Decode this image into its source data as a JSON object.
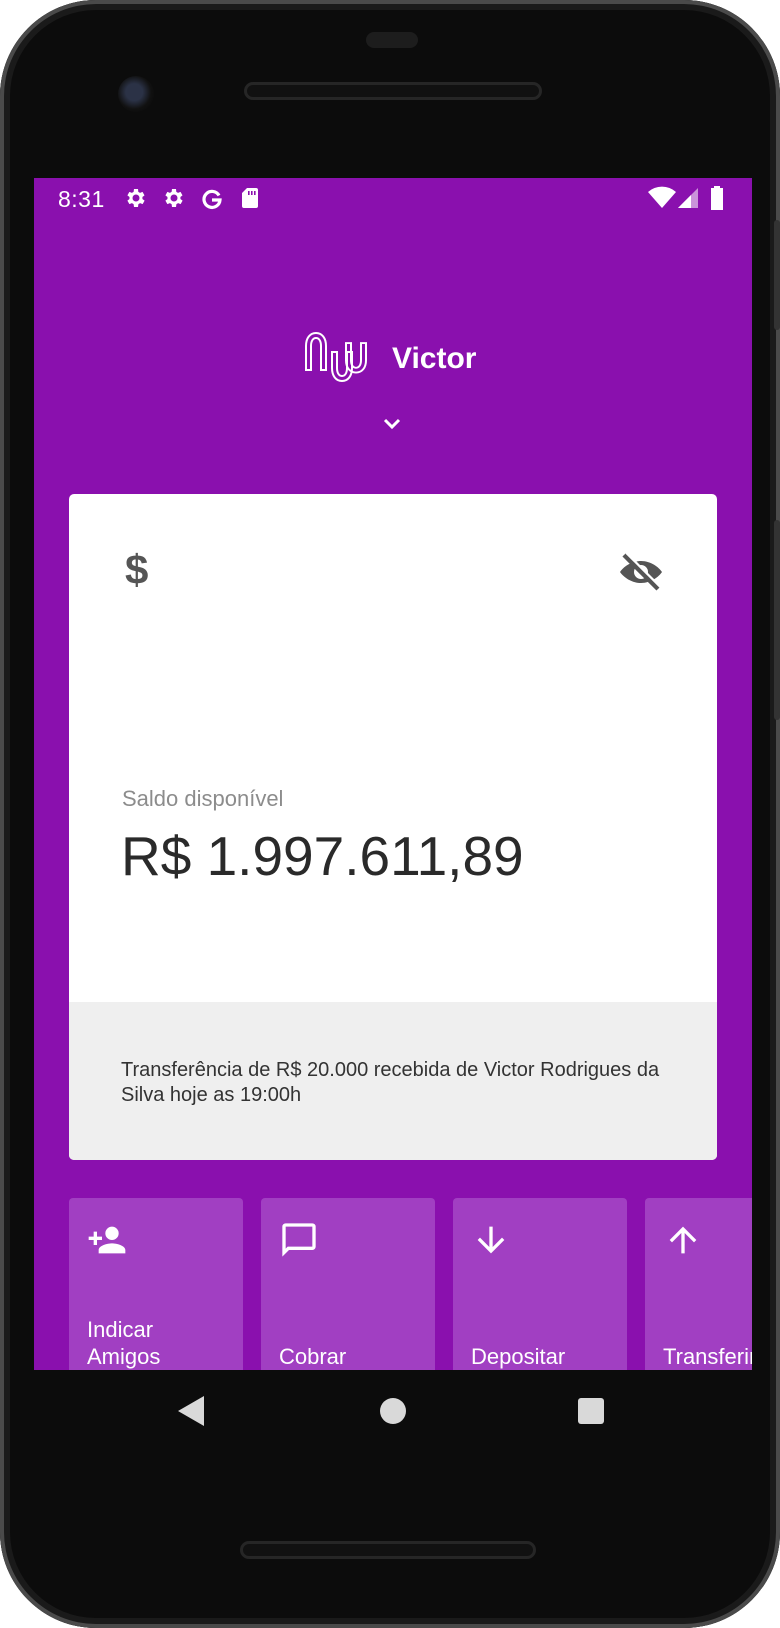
{
  "status_bar": {
    "time": "8:31",
    "icons_left": [
      "settings-icon",
      "settings-icon",
      "google-icon",
      "sd-card-icon"
    ],
    "icons_right": [
      "wifi-icon",
      "signal-icon",
      "battery-icon"
    ]
  },
  "header": {
    "logo": "nu-logo",
    "user_name": "Victor",
    "expand_icon": "chevron-down-icon"
  },
  "balance_card": {
    "currency_icon": "$",
    "visibility_icon": "eye-off-icon",
    "label": "Saldo disponível",
    "value": "R$ 1.997.611,89",
    "notification": "Transferência de R$ 20.000 recebida de Victor Rodrigues da Silva hoje as 19:00h"
  },
  "actions": [
    {
      "label": "Indicar\nAmigos",
      "icon": "person-add-icon"
    },
    {
      "label": "Cobrar",
      "icon": "chat-icon"
    },
    {
      "label": "Depositar",
      "icon": "arrow-down-icon"
    },
    {
      "label": "Transferir",
      "icon": "arrow-up-icon"
    }
  ],
  "colors": {
    "brand_purple": "#8a10ae",
    "action_purple": "#a13fc2",
    "card_footer": "#efefef"
  }
}
